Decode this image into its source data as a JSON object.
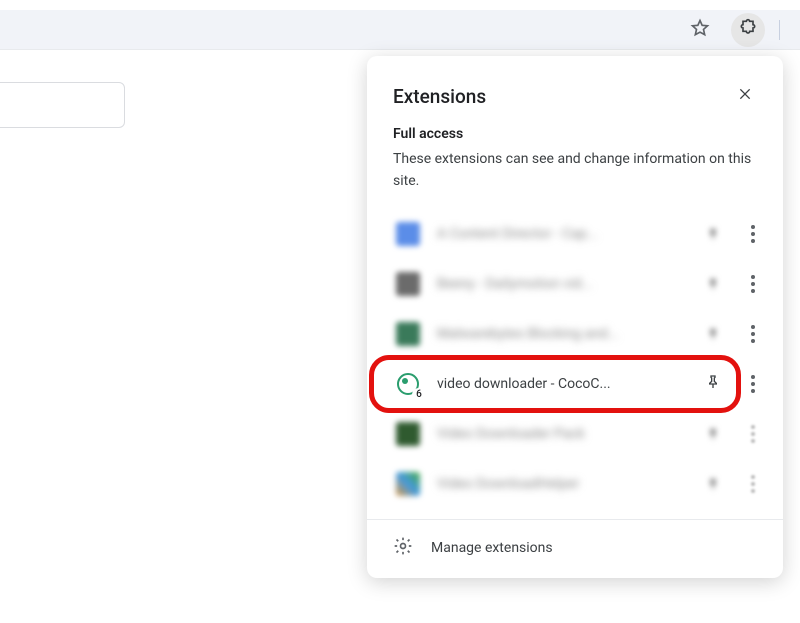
{
  "toolbar": {
    "star_title": "Bookmark this tab",
    "ext_title": "Extensions"
  },
  "popup": {
    "title": "Extensions",
    "close_title": "Close",
    "section_title": "Full access",
    "section_desc": "These extensions can see and change information on this site.",
    "manage_label": "Manage extensions",
    "highlighted": {
      "name": "video downloader - CocoC...",
      "badge": "6",
      "pin_title": "Pin"
    },
    "ext1": {
      "name": "A Content Director - Cap...",
      "pin_title": "Pin",
      "more_title": "More actions"
    },
    "ext2": {
      "name": "Beeny - Dailymotion vid...",
      "pin_title": "Pin",
      "more_title": "More actions"
    },
    "ext3": {
      "name": "Malwarebytes Blocking and...",
      "pin_title": "Pin",
      "more_title": "More actions"
    },
    "ext5": {
      "name": "Video Downloader Pack",
      "pin_title": "Pin",
      "more_title": "More actions"
    },
    "ext6": {
      "name": "Video DownloadHelper",
      "pin_title": "Pin",
      "more_title": "More actions"
    }
  }
}
